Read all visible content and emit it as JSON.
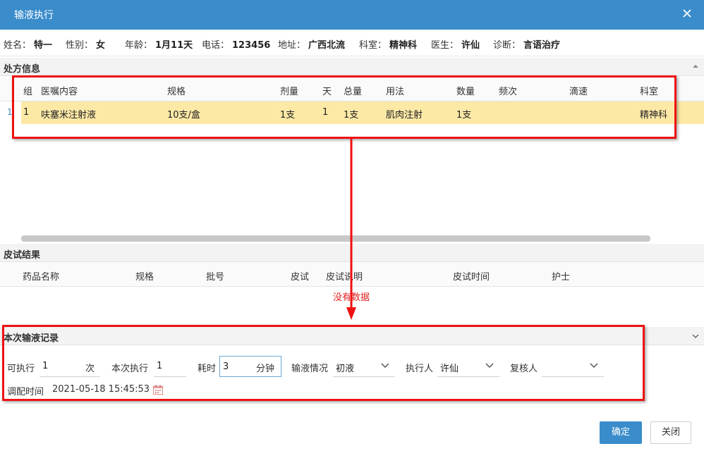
{
  "dialog": {
    "title": "输液执行"
  },
  "patient": [
    {
      "label": "姓名：",
      "value": "特一"
    },
    {
      "label": "性别：",
      "value": "女"
    },
    {
      "label": "年龄：",
      "value": "1月11天"
    },
    {
      "label": "电话：",
      "value": "123456"
    },
    {
      "label": "地址：",
      "value": "广西北流"
    },
    {
      "label": "科室：",
      "value": "精神科"
    },
    {
      "label": "医生：",
      "value": "许仙"
    },
    {
      "label": "诊断：",
      "value": "言语治疗"
    }
  ],
  "prescription": {
    "title": "处方信息",
    "columns": [
      "组",
      "医嘱内容",
      "规格",
      "剂量",
      "天",
      "总量",
      "用法",
      "数量",
      "频次",
      "滴速",
      "科室"
    ],
    "rows": [
      {
        "num": "1",
        "cells": [
          "1",
          "呋塞米注射液",
          "10支/盒",
          "1支",
          "1",
          "1支",
          "肌肉注射",
          "1支",
          "",
          "",
          "精神科"
        ]
      }
    ]
  },
  "skin_test": {
    "title": "皮试结果",
    "columns": [
      "药品名称",
      "规格",
      "批号",
      "皮试",
      "皮试说明",
      "皮试时间",
      "护士"
    ],
    "empty_text": "没有数据"
  },
  "record": {
    "title": "本次输液记录",
    "executable_label": "可执行",
    "executable_value": "1",
    "executable_unit": "次",
    "this_exec_label": "本次执行",
    "this_exec_value": "1",
    "duration_label": "耗时",
    "duration_value": "3",
    "duration_unit": "分钟",
    "status_label": "输液情况",
    "status_value": "初液",
    "executor_label": "执行人",
    "executor_value": "许仙",
    "reviewer_label": "复核人",
    "reviewer_value": "",
    "prep_time_label": "调配时间",
    "prep_time_value": "2021-05-18 15:45:53"
  },
  "buttons": {
    "ok": "确定",
    "close": "关闭"
  },
  "colors": {
    "titlebar": "#3a8ccb",
    "row_highlight": "#fde9a6",
    "annotation": "#e11111"
  }
}
